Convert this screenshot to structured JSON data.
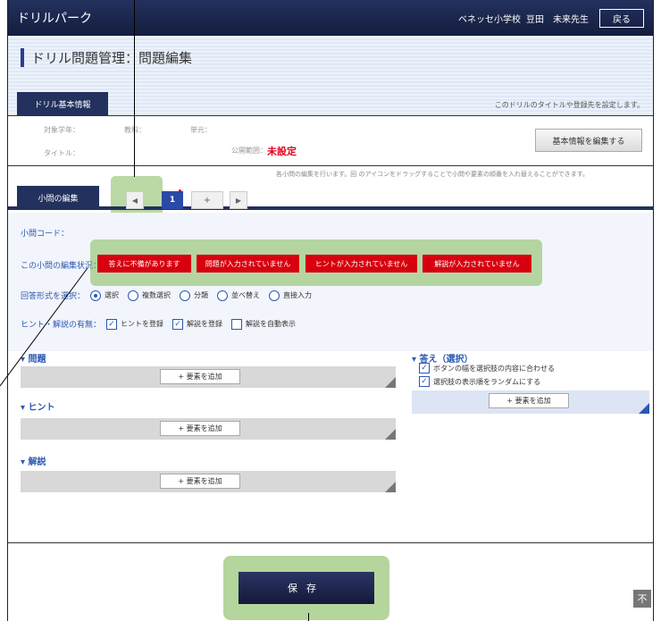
{
  "header": {
    "logo": "ドリルパーク",
    "school": "ベネッセ小学校",
    "teacher_name": "豆田　未来先生",
    "back_label": "戻る"
  },
  "page": {
    "title": "ドリル問題管理：問題編集",
    "basic_tab": "ドリル基本情報",
    "basic_hint": "このドリルのタイトルや登録先を設定します。"
  },
  "basic_info": {
    "target_grade_label": "対象学年：",
    "subject_label": "教科：",
    "unit_label": "単元：",
    "title_label": "タイトル：",
    "publish_label": "公開範囲：",
    "publish_value": "未設定",
    "edit_button": "基本情報を編集する"
  },
  "subquestion": {
    "hint": "各小問の編集を行います。回 のアイコンをドラッグすることで小問や要素の順番を入れ替えることができます。",
    "tab_label": "小問の編集",
    "prev_icon": "◀",
    "current_page": "1",
    "add_label": "+",
    "next_icon": "▶"
  },
  "settings": {
    "code_label": "小問コード：",
    "status_label": "この小問の編集状況：",
    "statuses": [
      "答えに不備があります",
      "問題が入力されていません",
      "ヒントが入力されていません",
      "解説が入力されていません"
    ],
    "answer_format_label": "回答形式を選択：",
    "answer_formats": [
      "選択",
      "複数選択",
      "分類",
      "並べ替え",
      "直接入力"
    ],
    "hint_label": "ヒント・解説の有無：",
    "hint_options": [
      "ヒントを登録",
      "解説を登録",
      "解説を自動表示"
    ]
  },
  "sections": {
    "question": "問題",
    "hint": "ヒント",
    "explanation": "解説",
    "answer": "答え（選択）",
    "add_element": "+ 要素を追加",
    "answer_options": [
      "ボタンの幅を選択肢の内容に合わせる",
      "選択肢の表示順をランダムにする"
    ]
  },
  "footer": {
    "save_label": "保存",
    "to_top_icon": "不"
  },
  "colors": {
    "navy": "#23315e",
    "status_red": "#d8000f",
    "highlight": "#82b95a"
  }
}
